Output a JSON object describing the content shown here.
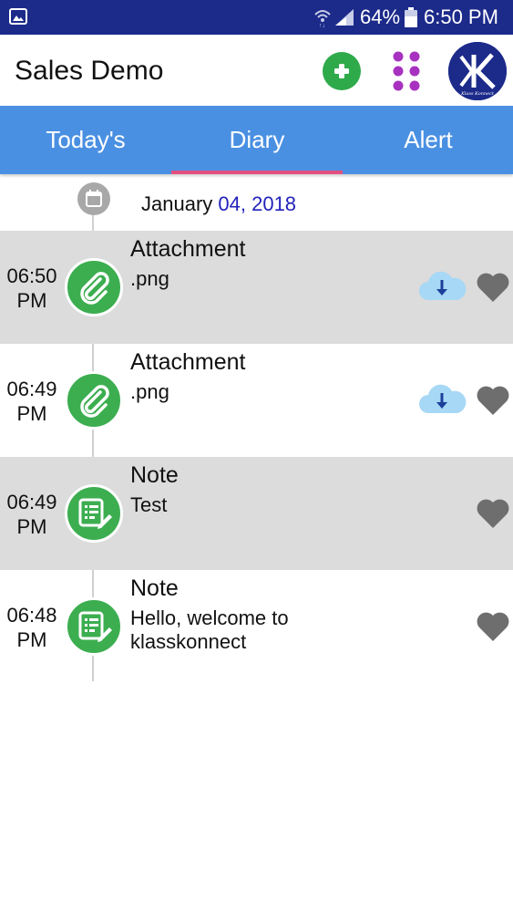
{
  "status_bar": {
    "battery": "64%",
    "time": "6:50 PM"
  },
  "header": {
    "title": "Sales Demo",
    "add_icon": "plus-circle-icon",
    "menu_icon": "grid-dots-icon",
    "logo_text": "Klass Konnect"
  },
  "tabs": [
    {
      "label": "Today's",
      "active": false
    },
    {
      "label": "Diary",
      "active": true
    },
    {
      "label": "Alert",
      "active": false
    }
  ],
  "date": {
    "month": "January",
    "day_year": "04, 2018"
  },
  "entries": [
    {
      "time": "06:50",
      "ampm": "PM",
      "type": "Attachment",
      "content": ".png",
      "icon": "paperclip-icon",
      "downloadable": true,
      "shaded": true
    },
    {
      "time": "06:49",
      "ampm": "PM",
      "type": "Attachment",
      "content": ".png",
      "icon": "paperclip-icon",
      "downloadable": true,
      "shaded": false
    },
    {
      "time": "06:49",
      "ampm": "PM",
      "type": "Note",
      "content": "Test",
      "icon": "note-edit-icon",
      "downloadable": false,
      "shaded": true
    },
    {
      "time": "06:48",
      "ampm": "PM",
      "type": "Note",
      "content": "Hello, welcome to klasskonnect",
      "icon": "note-edit-icon",
      "downloadable": false,
      "shaded": false
    }
  ],
  "colors": {
    "status_bar": "#1c2a8a",
    "tab_bar": "#4a90e2",
    "tab_indicator": "#e2507f",
    "badge_green": "#3cae50",
    "date_accent": "#2222bb",
    "row_shade": "#dcdcdc"
  }
}
